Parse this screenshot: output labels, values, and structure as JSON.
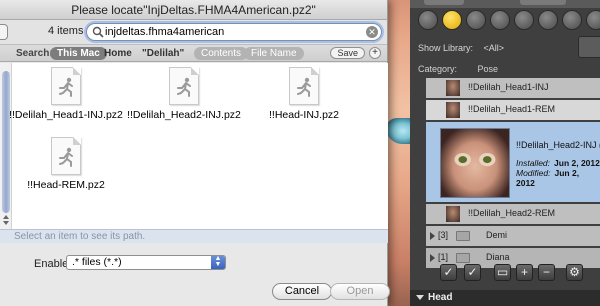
{
  "dialog": {
    "title": "Please locate\"InjDeltas.FHMA4American.pz2\"",
    "items_count": "4 items",
    "search_value": "injdeltas.fhma4american",
    "scope": {
      "label": "Search:",
      "this_mac": "This Mac",
      "home": "Home",
      "delilah": "\"Delilah\"",
      "contents": "Contents",
      "file_name": "File Name",
      "save": "Save",
      "add": "+"
    },
    "files": [
      {
        "name": "!!Delilah_Head1-INJ.pz2"
      },
      {
        "name": "!!Delilah_Head2-INJ.pz2"
      },
      {
        "name": "!!Head-INJ.pz2"
      },
      {
        "name": "!!Head-REM.pz2"
      }
    ],
    "path_hint": "Select an item to see its path.",
    "enable_label": "Enable:",
    "enable_value": ".* files (*.*)",
    "cancel_label": "Cancel",
    "open_label": "Open"
  },
  "library": {
    "show_library_label": "Show Library:",
    "show_library_value": "<All>",
    "category_label": "Category:",
    "category_value": "Pose",
    "items": [
      {
        "label": "!!Delilah_Head1-INJ"
      },
      {
        "label": "!!Delilah_Head1-REM"
      }
    ],
    "selected": {
      "label": "!!Delilah_Head2-INJ (load",
      "installed_label": "Installed:",
      "installed_date": "Jun 2, 2012",
      "modified_label": "Modified:",
      "modified_date": "Jun 2, 2012"
    },
    "after_item": {
      "label": "!!Delilah_Head2-REM"
    },
    "folders": [
      {
        "count": "[3]",
        "name": "Demi"
      },
      {
        "count": "[1]",
        "name": "Diana"
      }
    ],
    "footer": "Head"
  }
}
